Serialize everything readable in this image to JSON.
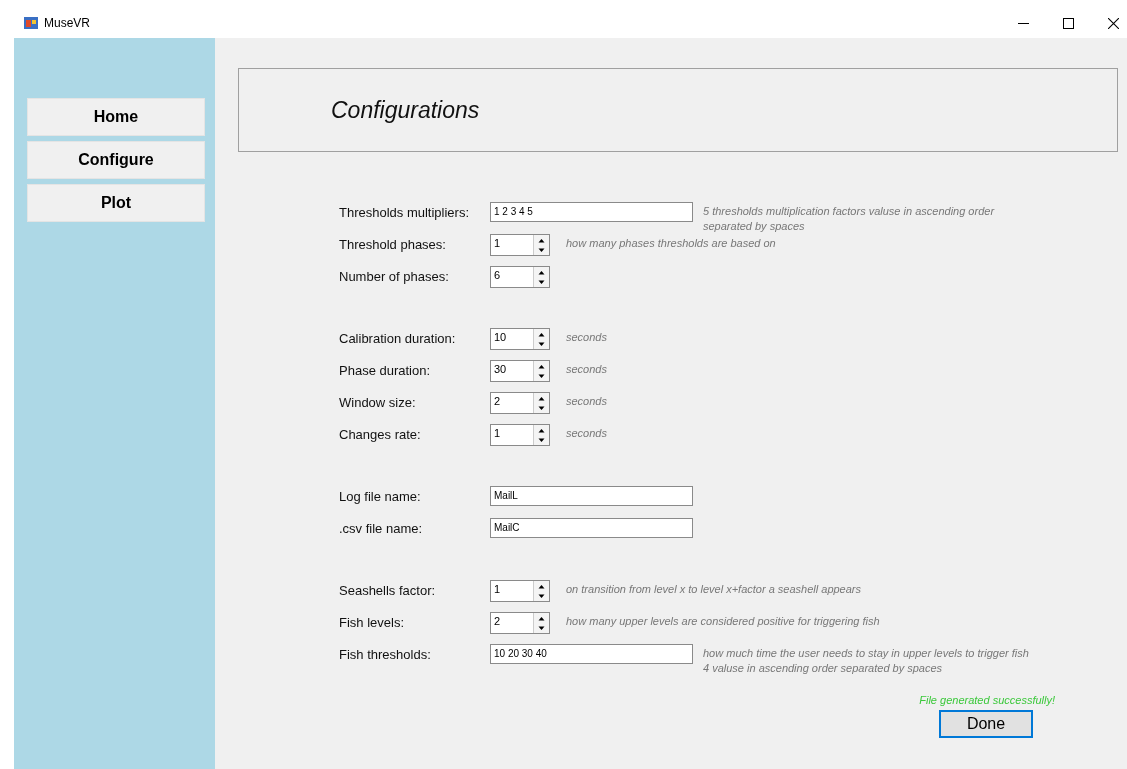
{
  "window": {
    "title": "MuseVR"
  },
  "nav": [
    {
      "label": "Home"
    },
    {
      "label": "Configure"
    },
    {
      "label": "Plot"
    }
  ],
  "header": {
    "title": "Configurations"
  },
  "sections": [
    [
      {
        "kind": "text",
        "label": "Thresholds multipliers:",
        "value": "1 2 3 4 5",
        "hint": [
          "5 thresholds multiplication factors valuse in ascending order",
          "separated by spaces"
        ]
      },
      {
        "kind": "spin",
        "label": "Threshold phases:",
        "value": "1",
        "hint": [
          "how many phases thresholds are based on"
        ]
      },
      {
        "kind": "spin",
        "label": "Number of phases:",
        "value": "6"
      }
    ],
    [
      {
        "kind": "spin",
        "label": "Calibration duration:",
        "value": "10",
        "hint": [
          "seconds"
        ]
      },
      {
        "kind": "spin",
        "label": "Phase duration:",
        "value": "30",
        "hint": [
          "seconds"
        ]
      },
      {
        "kind": "spin",
        "label": "Window size:",
        "value": "2",
        "hint": [
          "seconds"
        ]
      },
      {
        "kind": "spin",
        "label": "Changes rate:",
        "value": "1",
        "hint": [
          "seconds"
        ]
      }
    ],
    [
      {
        "kind": "text",
        "label": "Log file name:",
        "value": "MailL"
      },
      {
        "kind": "text",
        "label": ".csv file name:",
        "value": "MailC"
      }
    ],
    [
      {
        "kind": "spin",
        "label": "Seashells factor:",
        "value": "1",
        "hint": [
          "on transition from level x to level x+factor a seashell appears"
        ]
      },
      {
        "kind": "spin",
        "label": "Fish levels:",
        "value": "2",
        "hint": [
          "how many upper levels are considered positive for triggering fish"
        ]
      },
      {
        "kind": "text",
        "label": "Fish thresholds:",
        "value": "10 20 30 40",
        "hint": [
          "how much time the user needs to stay in upper levels to trigger fish",
          "4 valuse in ascending order separated by spaces"
        ]
      }
    ]
  ],
  "status": "File generated successfully!",
  "done_button": {
    "label": "Done",
    "focused": true
  }
}
